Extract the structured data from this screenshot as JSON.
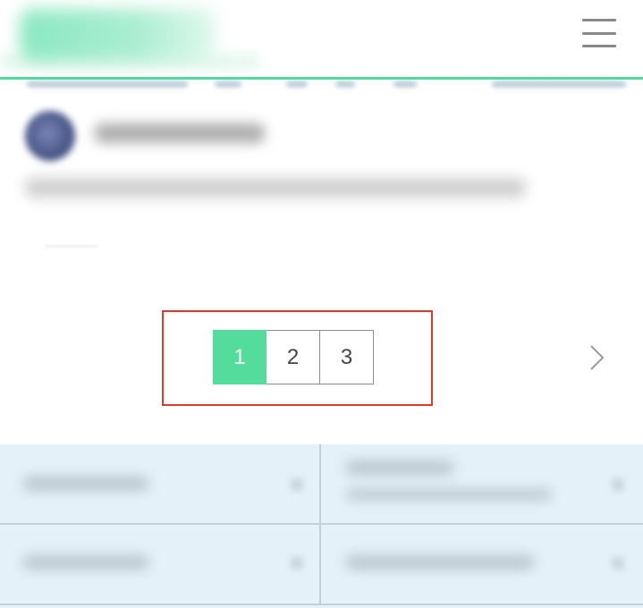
{
  "header": {
    "menu_icon": "hamburger-menu-icon",
    "accent_color": "#4fdc9b"
  },
  "pagination": {
    "pages": [
      "1",
      "2",
      "3"
    ],
    "current": "1",
    "next_icon": "chevron-right-icon",
    "active_color": "#53dc9c",
    "highlight_color": "#e23a2a"
  }
}
